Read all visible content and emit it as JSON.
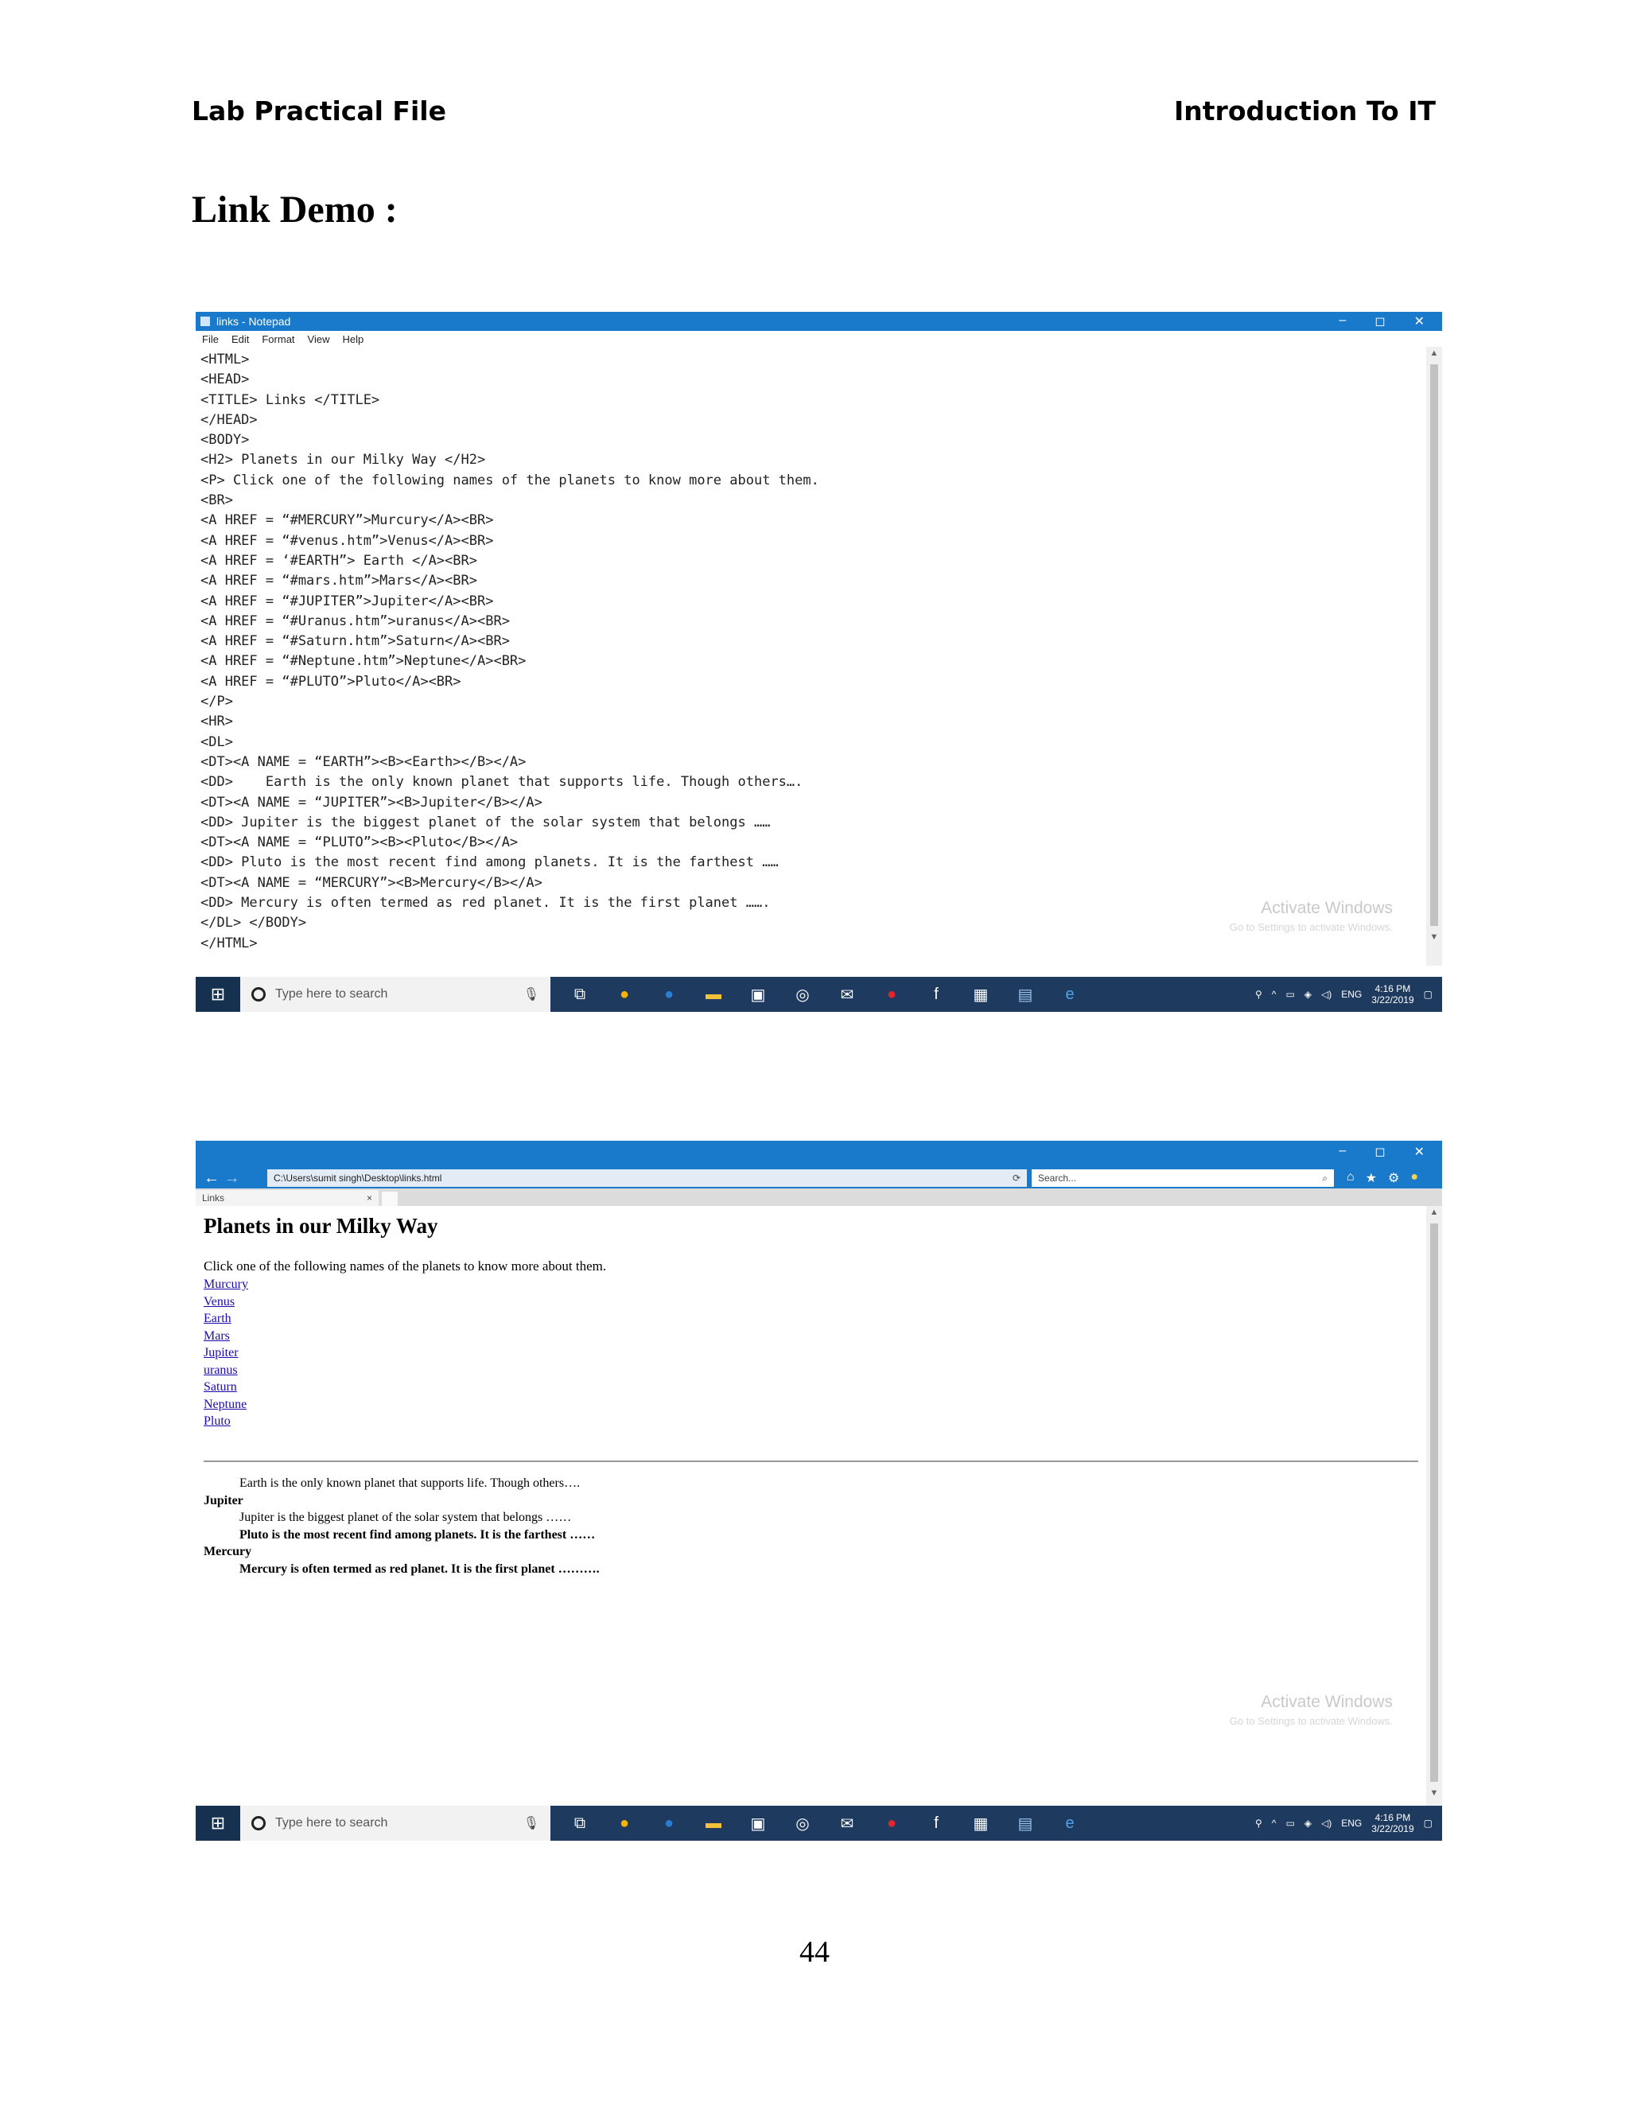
{
  "header": {
    "left": "Lab Practical File",
    "right": "Introduction To IT"
  },
  "section_title": "Link Demo :",
  "notepad": {
    "title": "links - Notepad",
    "window_controls": [
      "–",
      "◻",
      "✕"
    ],
    "menu": [
      "File",
      "Edit",
      "Format",
      "View",
      "Help"
    ],
    "code_lines": [
      "<HTML>",
      "<HEAD>",
      "<TITLE> Links </TITLE>",
      "</HEAD>",
      "<BODY>",
      "<H2> Planets in our Milky Way </H2>",
      "<P> Click one of the following names of the planets to know more about them.",
      "<BR>",
      "<A HREF = “#MERCURY”>Murcury</A><BR>",
      "<A HREF = “#venus.htm”>Venus</A><BR>",
      "<A HREF = ‘#EARTH”> Earth </A><BR>",
      "<A HREF = “#mars.htm”>Mars</A><BR>",
      "<A HREF = “#JUPITER”>Jupiter</A><BR>",
      "<A HREF = “#Uranus.htm”>uranus</A><BR>",
      "<A HREF = “#Saturn.htm”>Saturn</A><BR>",
      "<A HREF = “#Neptune.htm”>Neptune</A><BR>",
      "<A HREF = “#PLUTO”>Pluto</A><BR>",
      "</P>",
      "<HR>",
      "<DL>",
      "<DT><A NAME = “EARTH”><B><Earth></B></A>",
      "<DD>    Earth is the only known planet that supports life. Though others….",
      "<DT><A NAME = “JUPITER”><B>Jupiter</B></A>",
      "<DD> Jupiter is the biggest planet of the solar system that belongs ……",
      "<DT><A NAME = “PLUTO”><B><Pluto</B></A>",
      "<DD> Pluto is the most recent find among planets. It is the farthest ……",
      "<DT><A NAME = “MERCURY”><B>Mercury</B></A>",
      "<DD> Mercury is often termed as red planet. It is the first planet …….",
      "</DL> </BODY>",
      "</HTML>"
    ]
  },
  "activate": {
    "title": "Activate Windows",
    "sub": "Go to Settings to activate Windows."
  },
  "taskbar": {
    "search_placeholder": "Type here to search",
    "icons": [
      "task-view-icon",
      "chrome-icon",
      "edge-icon",
      "file-explorer-icon",
      "store-icon",
      "camera-icon",
      "mail-icon",
      "opera-icon",
      "facebook-icon",
      "calculator-icon",
      "notepad-icon",
      "ie-icon"
    ],
    "lang": "ENG",
    "time": "4:16 PM",
    "date": "3/22/2019"
  },
  "browser": {
    "address": "C:\\Users\\sumit singh\\Desktop\\links.html",
    "search_placeholder": "Search...",
    "tab_label": "Links",
    "window_controls": [
      "–",
      "◻",
      "✕"
    ],
    "heading": "Planets in our Milky Way",
    "intro": "Click one of the following names of the planets to know more about them.",
    "links": [
      "Murcury",
      "Venus",
      "Earth",
      "Mars",
      "Jupiter",
      "uranus",
      "Saturn",
      "Neptune",
      "Pluto"
    ],
    "dl": {
      "earth_dd": "Earth is the only known planet that supports life. Though others….",
      "jupiter_dt": "Jupiter",
      "jupiter_dd": "Jupiter is the biggest planet of the solar system that belongs ……",
      "pluto_dd": "Pluto is the most recent find among planets. It is the farthest ……",
      "mercury_dt": "Mercury",
      "mercury_dd": "Mercury is often termed as red planet. It is the first planet ………."
    }
  },
  "page_number": "44"
}
